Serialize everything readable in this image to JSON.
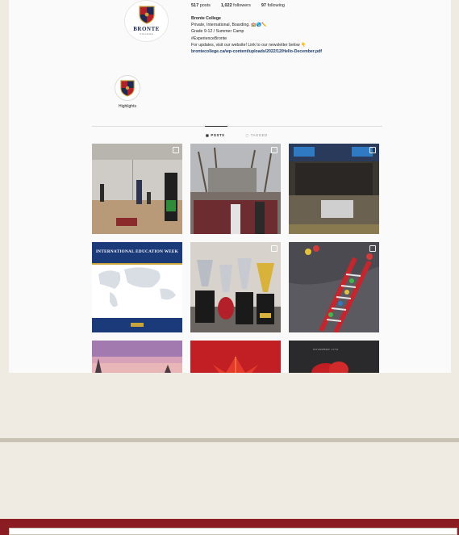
{
  "profile": {
    "avatar_name": "BRONTE",
    "avatar_sub": "COLLEGE",
    "stats": {
      "posts_count": "517",
      "posts_label": "posts",
      "followers_count": "1,022",
      "followers_label": "followers",
      "following_count": "97",
      "following_label": "following"
    },
    "bio": {
      "name": "Bronte College",
      "line1": "Private, International, Boarding. 🏫🌎✏️",
      "line2": "Grade 9-12 / Summer Camp",
      "line3": "#ExperienceBronte",
      "line4": "For updates, visit our website! Link to our newsletter below 👇",
      "link": "brontecollege.ca/wp-content/uploads/2022/12/Hello-December.pdf"
    },
    "highlight_label": "Highlights"
  },
  "tabs": {
    "posts": "POSTS",
    "tagged": "TAGGED"
  },
  "posts": {
    "edu_week_title": "INTERNATIONAL EDUCATION WEEK",
    "last_tile_text": "NOVEMBER 11TH"
  },
  "colors": {
    "page_bg": "#efebe2",
    "footer_red": "#8b1c22",
    "navy": "#1e2a55",
    "rule": "#c9c1b2"
  }
}
